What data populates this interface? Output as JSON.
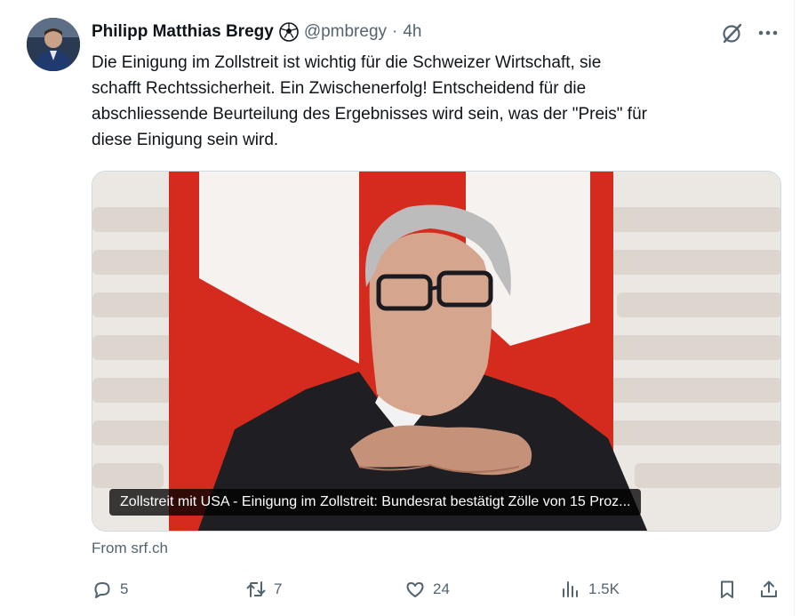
{
  "author": {
    "name": "Philipp Matthias Bregy",
    "handle": "@pmbregy",
    "separator": "·",
    "time": "4h"
  },
  "icons": {
    "badge": "soccer-ball-icon",
    "grok": "grok-icon",
    "more": "more-icon",
    "reply": "reply-icon",
    "retweet": "retweet-icon",
    "like": "heart-icon",
    "views": "views-icon",
    "bookmark": "bookmark-icon",
    "share": "share-icon"
  },
  "tweet": {
    "lines": [
      "Die Einigung im Zollstreit ist wichtig für die Schweizer Wirtschaft, sie",
      "schafft Rechtssicherheit. Ein Zwischenerfolg! Entscheidend für die",
      "abschliessende Beurteilung des Ergebnisses wird sein, was der \"Preis\" für",
      "diese Einigung sein wird."
    ]
  },
  "card": {
    "caption": "Zollstreit mit USA - Einigung im Zollstreit: Bundesrat bestätigt Zölle von 15 Proz...",
    "source": "From srf.ch"
  },
  "actions": {
    "replies": "5",
    "reposts": "7",
    "likes": "24",
    "views": "1.5K"
  },
  "colors": {
    "text": "#0f1419",
    "secondary": "#536471",
    "flag_red": "#d52b1e",
    "border": "#cfd9de"
  }
}
